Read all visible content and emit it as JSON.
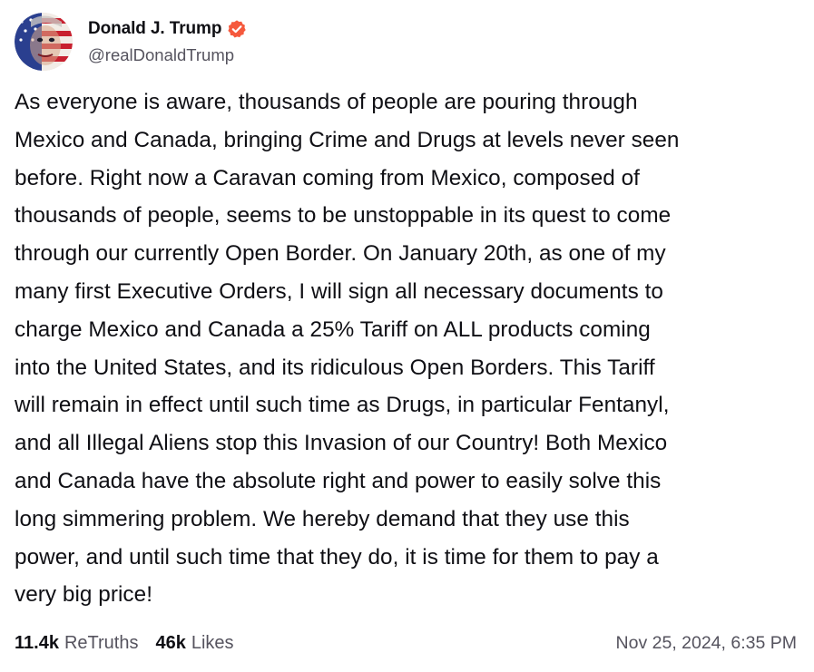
{
  "author": {
    "display_name": "Donald J. Trump",
    "handle": "@realDonaldTrump",
    "verified": true,
    "verified_badge_color": "#f5593d",
    "avatar_icon": "flag-portrait-avatar"
  },
  "post": {
    "text": "As everyone is aware, thousands of people are pouring through\nMexico and Canada, bringing Crime and Drugs at levels never seen\nbefore. Right now a Caravan coming from Mexico, composed of\nthousands of people, seems to be unstoppable in its quest to come\nthrough our currently Open Border. On January 20th, as one of my\nmany first Executive Orders, I will sign all necessary documents to\ncharge Mexico and Canada a 25% Tariff on ALL products coming\ninto the United States, and its ridiculous Open Borders. This Tariff\nwill remain in effect until such time as Drugs, in particular Fentanyl,\nand all Illegal Aliens stop this Invasion of our Country! Both Mexico\nand Canada have the absolute right and power to easily solve this\nlong simmering problem. We hereby demand that they use this\npower, and until such time that they do, it is time for them to pay a\nvery big price!"
  },
  "stats": {
    "retruths_count": "11.4k",
    "retruths_label": "ReTruths",
    "likes_count": "46k",
    "likes_label": "Likes"
  },
  "timestamp": "Nov 25, 2024, 6:35 PM"
}
